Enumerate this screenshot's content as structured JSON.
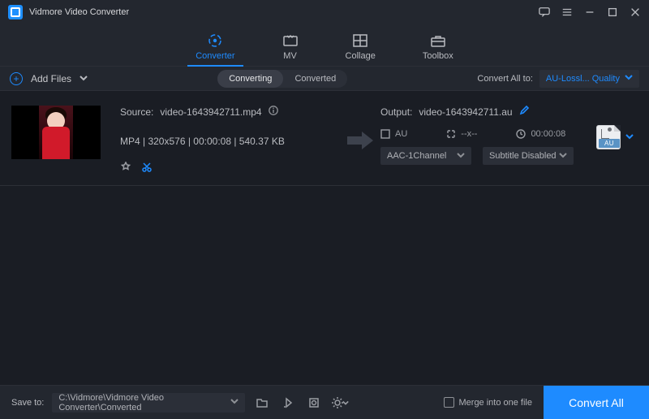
{
  "app": {
    "title": "Vidmore Video Converter"
  },
  "nav": {
    "tabs": [
      {
        "label": "Converter",
        "active": true
      },
      {
        "label": "MV",
        "active": false
      },
      {
        "label": "Collage",
        "active": false
      },
      {
        "label": "Toolbox",
        "active": false
      }
    ]
  },
  "toolbar": {
    "add_files": "Add Files",
    "subtabs": {
      "converting": "Converting",
      "converted": "Converted",
      "active": "converting"
    },
    "convert_all_to": "Convert All to:",
    "format_selected": "AU-Lossl... Quality"
  },
  "item": {
    "source_label": "Source:",
    "source_name": "video-1643942711.mp4",
    "meta": "MP4 | 320x576 | 00:00:08 | 540.37 KB",
    "output_label": "Output:",
    "output_name": "video-1643942711.au",
    "format_short": "AU",
    "resolution_placeholder": "--x--",
    "duration": "00:00:08",
    "audio_selected": "AAC-1Channel",
    "subtitle_selected": "Subtitle Disabled",
    "format_badge": "AU"
  },
  "bottom": {
    "saveto_label": "Save to:",
    "saveto_path": "C:\\Vidmore\\Vidmore Video Converter\\Converted",
    "merge_label": "Merge into one file",
    "convert_all": "Convert All"
  }
}
